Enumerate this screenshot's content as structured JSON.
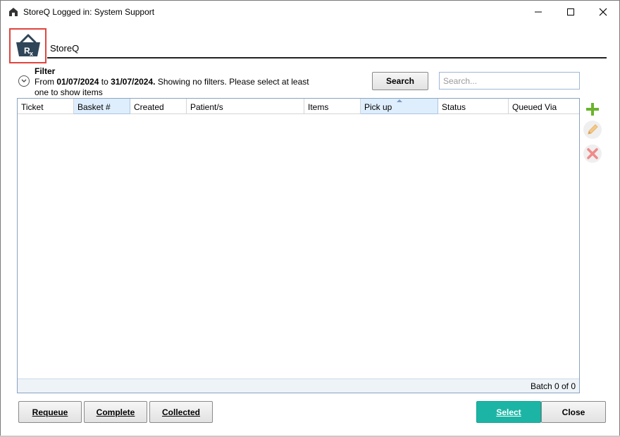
{
  "window": {
    "title": "StoreQ Logged in: System Support"
  },
  "header": {
    "app_name": "StoreQ"
  },
  "filter": {
    "label": "Filter",
    "prefix": "From ",
    "date_from": "01/07/2024",
    "to_word": " to ",
    "date_to": "31/07/2024.",
    "suffix": " Showing no filters. Please select at least one to show items"
  },
  "search": {
    "button_label": "Search",
    "placeholder": "Search..."
  },
  "grid": {
    "columns": [
      "Ticket",
      "Basket #",
      "Created",
      "Patient/s",
      "Items",
      "Pick up",
      "Status",
      "Queued Via"
    ],
    "rows": [],
    "footer": "Batch 0 of 0"
  },
  "actions": {
    "requeue": "Requeue",
    "complete": "Complete",
    "collected": "Collected",
    "select": "Select",
    "close": "Close"
  },
  "colors": {
    "accent": "#1cb5a5",
    "highlight_border": "#e0453e",
    "add_green": "#6ab42d"
  }
}
